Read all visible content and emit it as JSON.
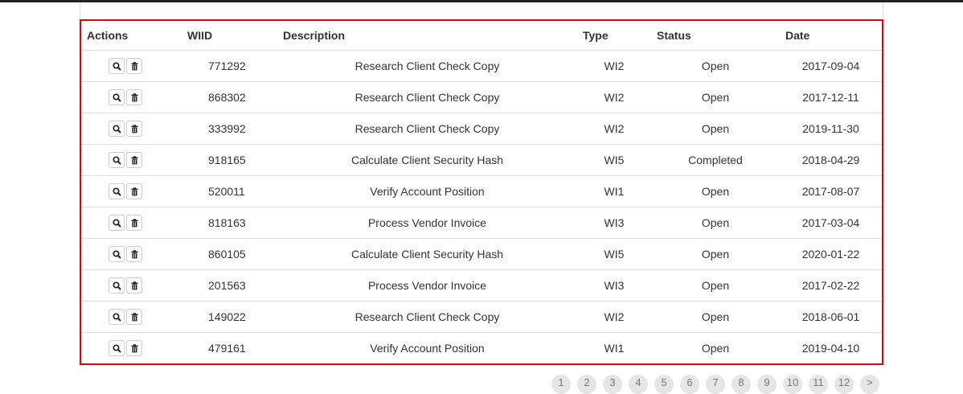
{
  "table": {
    "headers": {
      "actions": "Actions",
      "wiid": "WIID",
      "description": "Description",
      "type": "Type",
      "status": "Status",
      "date": "Date"
    },
    "rows": [
      {
        "wiid": "771292",
        "description": "Research Client Check Copy",
        "type": "WI2",
        "status": "Open",
        "date": "2017-09-04"
      },
      {
        "wiid": "868302",
        "description": "Research Client Check Copy",
        "type": "WI2",
        "status": "Open",
        "date": "2017-12-11"
      },
      {
        "wiid": "333992",
        "description": "Research Client Check Copy",
        "type": "WI2",
        "status": "Open",
        "date": "2019-11-30"
      },
      {
        "wiid": "918165",
        "description": "Calculate Client Security Hash",
        "type": "WI5",
        "status": "Completed",
        "date": "2018-04-29"
      },
      {
        "wiid": "520011",
        "description": "Verify Account Position",
        "type": "WI1",
        "status": "Open",
        "date": "2017-08-07"
      },
      {
        "wiid": "818163",
        "description": "Process Vendor Invoice",
        "type": "WI3",
        "status": "Open",
        "date": "2017-03-04"
      },
      {
        "wiid": "860105",
        "description": "Calculate Client Security Hash",
        "type": "WI5",
        "status": "Open",
        "date": "2020-01-22"
      },
      {
        "wiid": "201563",
        "description": "Process Vendor Invoice",
        "type": "WI3",
        "status": "Open",
        "date": "2017-02-22"
      },
      {
        "wiid": "149022",
        "description": "Research Client Check Copy",
        "type": "WI2",
        "status": "Open",
        "date": "2018-06-01"
      },
      {
        "wiid": "479161",
        "description": "Verify Account Position",
        "type": "WI1",
        "status": "Open",
        "date": "2019-04-10"
      }
    ],
    "row_actions": {
      "view_icon": "search-icon",
      "delete_icon": "trash-icon"
    }
  },
  "pagination": {
    "pages": [
      "1",
      "2",
      "3",
      "4",
      "5",
      "6",
      "7",
      "8",
      "9",
      "10",
      "11",
      "12",
      ">"
    ]
  },
  "colors": {
    "highlight_border": "#d9090c",
    "row_divider": "#dddddd",
    "page_button_bg": "#e6e6e6"
  }
}
